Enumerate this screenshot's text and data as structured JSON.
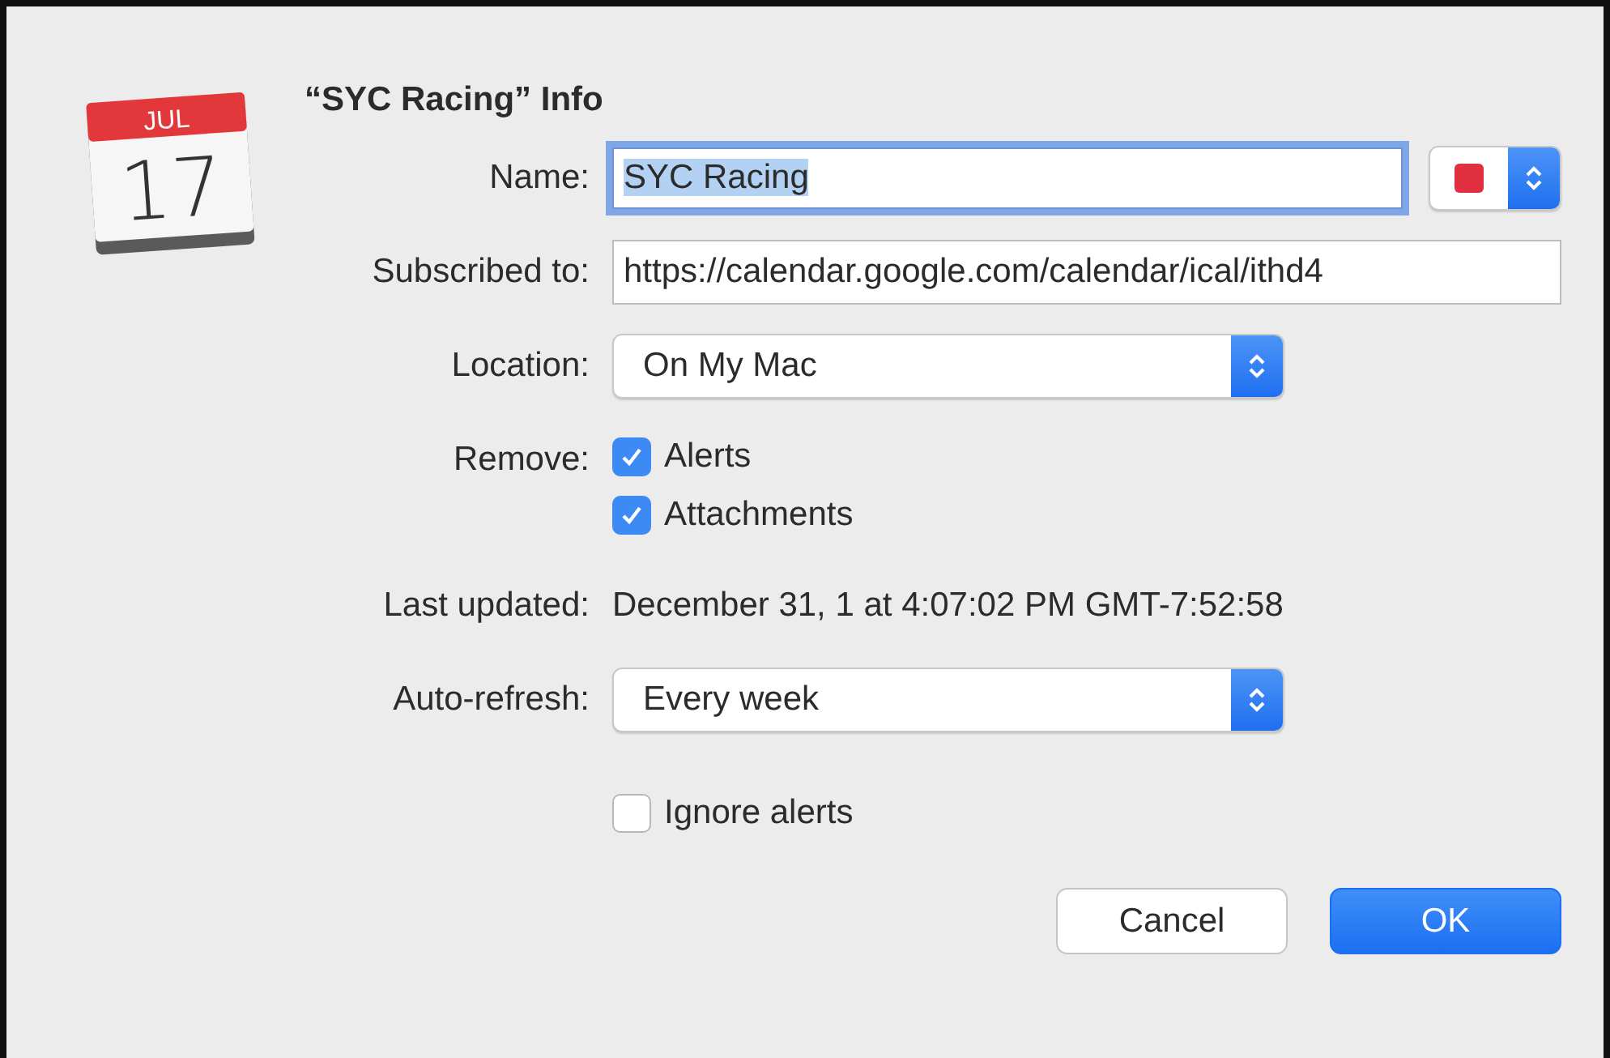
{
  "dialog": {
    "title": "“SYC Racing” Info",
    "icon": {
      "month": "JUL",
      "day": "17"
    }
  },
  "fields": [
    {
      "kind": "text",
      "label": "Name:",
      "value": "SYC Racing",
      "focused": true,
      "selected": true,
      "color_popup": {
        "color": "#e0303f"
      }
    },
    {
      "kind": "text",
      "label": "Subscribed to:",
      "value": "https://calendar.google.com/calendar/ical/ithd4",
      "focused": false,
      "selected": false
    },
    {
      "kind": "popup",
      "label": "Location:",
      "value": "On My Mac"
    },
    {
      "kind": "checks",
      "label": "Remove:",
      "options": [
        {
          "label": "Alerts",
          "checked": true
        },
        {
          "label": "Attachments",
          "checked": true
        }
      ]
    },
    {
      "kind": "info",
      "label": "Last updated:",
      "value": "December 31, 1 at 4:07:02 PM GMT-7:52:58"
    },
    {
      "kind": "popup",
      "label": "Auto-refresh:",
      "value": "Every week"
    },
    {
      "kind": "checks",
      "options": [
        {
          "label": "Ignore alerts",
          "checked": false
        }
      ]
    }
  ],
  "buttons": [
    {
      "label": "Cancel",
      "default": false
    },
    {
      "label": "OK",
      "default": true
    }
  ]
}
